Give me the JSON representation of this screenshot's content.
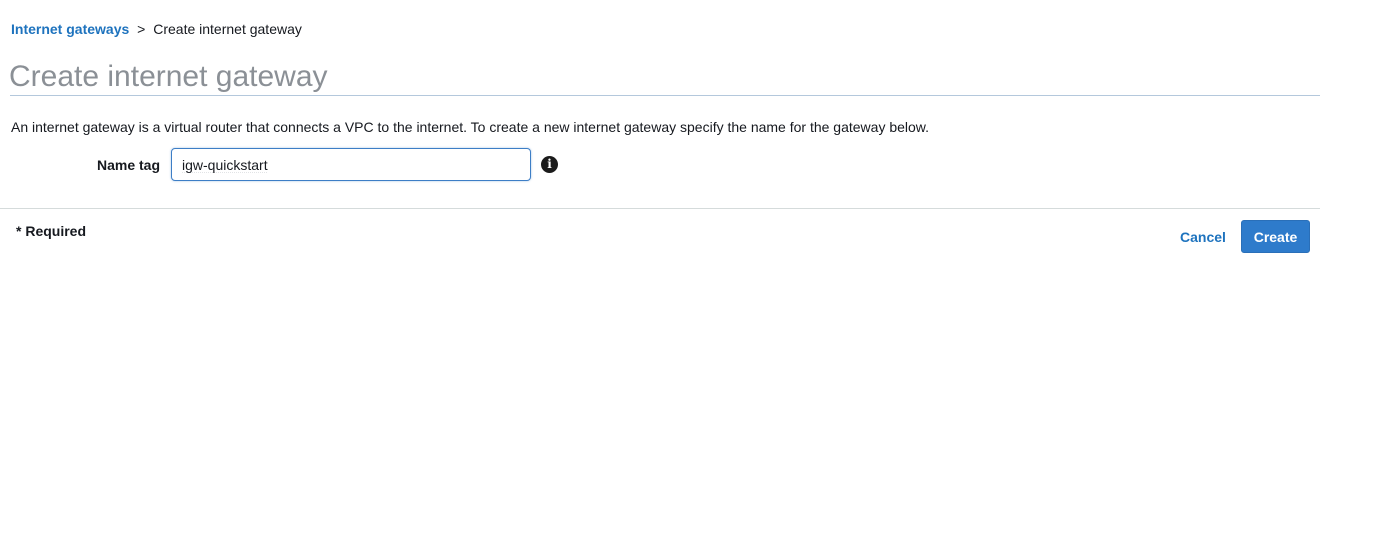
{
  "breadcrumb": {
    "parent": "Internet gateways",
    "separator": ">",
    "current": "Create internet gateway"
  },
  "page": {
    "title": "Create internet gateway",
    "description": "An internet gateway is a virtual router that connects a VPC to the internet. To create a new internet gateway specify the name for the gateway below."
  },
  "form": {
    "name_tag_label": "Name tag",
    "name_tag_value": "igw-quickstart",
    "info_icon": "info-circle-icon",
    "info_glyph": "i"
  },
  "footer": {
    "required_note": "* Required",
    "cancel_label": "Cancel",
    "create_label": "Create"
  },
  "colors": {
    "link": "#1e73be",
    "primary_button": "#2e7bcb",
    "title_text": "#8b9096"
  }
}
